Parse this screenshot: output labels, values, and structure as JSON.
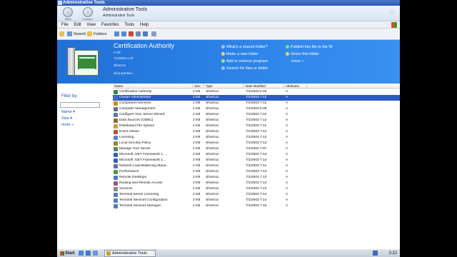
{
  "window": {
    "title": "Administrative Tools"
  },
  "nav": {
    "back_label": "Back",
    "forward_label": "Forward",
    "location_title": "Administrative Tools",
    "location_sub": "Administrative Tools"
  },
  "menu": [
    "File",
    "Edit",
    "View",
    "Favorites",
    "Tools",
    "Help"
  ],
  "toolbar": {
    "search_label": "Search",
    "folders_label": "Folders"
  },
  "banner": {
    "title": "Certification Authority",
    "size": "2 KB",
    "date": "7/1/2003 1:40",
    "type": "Shortcut",
    "all_properties": "all properties...",
    "tasks_left": [
      "What's a shared folder?",
      "Make a new folder",
      "Add or remove program",
      "Search for files or folder"
    ],
    "tasks_right": [
      "Publish this file to the W",
      "Share this folder",
      "more"
    ]
  },
  "left": {
    "filter_label": "Filter by:",
    "items": [
      "Name",
      "Size",
      "more"
    ]
  },
  "columns": [
    "Name",
    "Size",
    "Type",
    "Date Modified",
    "Attributes"
  ],
  "files": [
    {
      "name": "Certification Authority",
      "size": "2 KB",
      "type": "Shortcut",
      "date": "7/1/2003 5:48",
      "attr": "A",
      "color": "#3a8a3a"
    },
    {
      "name": "Cluster Administrator",
      "size": "2 KB",
      "type": "Shortcut",
      "date": "7/1/2003 7:12",
      "attr": "A",
      "color": "#4a6ab8",
      "selected": true
    },
    {
      "name": "Component Services",
      "size": "2 KB",
      "type": "Shortcut",
      "date": "7/1/2003 7:12",
      "attr": "A",
      "color": "#c88a20"
    },
    {
      "name": "Computer Management",
      "size": "2 KB",
      "type": "Shortcut",
      "date": "7/1/2003 5:38",
      "attr": "A",
      "color": "#6a6a8a"
    },
    {
      "name": "Configure Your Server Wizard",
      "size": "2 KB",
      "type": "Shortcut",
      "date": "7/1/2003 7:12",
      "attr": "A",
      "color": "#5a7ab0"
    },
    {
      "name": "Data Sources (ODBC)",
      "size": "2 KB",
      "type": "Shortcut",
      "date": "7/1/2003 7:12",
      "attr": "A",
      "color": "#8a6a3a"
    },
    {
      "name": "Distributed File System",
      "size": "2 KB",
      "type": "Shortcut",
      "date": "7/1/2003 7:12",
      "attr": "A",
      "color": "#c8a040"
    },
    {
      "name": "Event Viewer",
      "size": "2 KB",
      "type": "Shortcut",
      "date": "7/1/2003 7:12",
      "attr": "A",
      "color": "#c84a30"
    },
    {
      "name": "Licensing",
      "size": "2 KB",
      "type": "Shortcut",
      "date": "7/1/2003 7:12",
      "attr": "A",
      "color": "#4a8ac8"
    },
    {
      "name": "Local Security Policy",
      "size": "2 KB",
      "type": "Shortcut",
      "date": "7/1/2003 7:12",
      "attr": "A",
      "color": "#8a8a3a"
    },
    {
      "name": "Manage Your Server",
      "size": "2 KB",
      "type": "Shortcut",
      "date": "7/1/2003 7:07",
      "attr": "A",
      "color": "#5a8a5a"
    },
    {
      "name": "Microsoft .NET Framework 1....",
      "size": "2 KB",
      "type": "Shortcut",
      "date": "7/1/2003 7:13",
      "attr": "A",
      "color": "#3a5ab8"
    },
    {
      "name": "Microsoft .NET Framework 1....",
      "size": "2 KB",
      "type": "Shortcut",
      "date": "7/1/2003 7:13",
      "attr": "A",
      "color": "#3a5ab8"
    },
    {
      "name": "Network Load Balancing Mana...",
      "size": "2 KB",
      "type": "Shortcut",
      "date": "7/1/2003 7:12",
      "attr": "A",
      "color": "#6a6aa8"
    },
    {
      "name": "Performance",
      "size": "2 KB",
      "type": "Shortcut",
      "date": "7/1/2003 7:13",
      "attr": "A",
      "color": "#4a9a4a"
    },
    {
      "name": "Remote Desktops",
      "size": "2 KB",
      "type": "Shortcut",
      "date": "7/1/2003 7:13",
      "attr": "A",
      "color": "#4a7ac8"
    },
    {
      "name": "Routing and Remote Access",
      "size": "2 KB",
      "type": "Shortcut",
      "date": "7/1/2003 7:13",
      "attr": "A",
      "color": "#8a5a8a"
    },
    {
      "name": "Services",
      "size": "2 KB",
      "type": "Shortcut",
      "date": "7/1/2003 7:13",
      "attr": "A",
      "color": "#8a8a8a"
    },
    {
      "name": "Terminal Server Licensing",
      "size": "2 KB",
      "type": "Shortcut",
      "date": "7/1/2003 7:14",
      "attr": "A",
      "color": "#5a7ab8"
    },
    {
      "name": "Terminal Services Configuration",
      "size": "2 KB",
      "type": "Shortcut",
      "date": "7/1/2003 7:14",
      "attr": "A",
      "color": "#5a7ab8"
    },
    {
      "name": "Terminal Services Manager",
      "size": "2 KB",
      "type": "Shortcut",
      "date": "7/1/2003 7:15",
      "attr": "A",
      "color": "#5a7ab8"
    }
  ],
  "taskbar": {
    "start_label": "Start",
    "task_label": "Administrative Tools",
    "clock": "3:22"
  }
}
